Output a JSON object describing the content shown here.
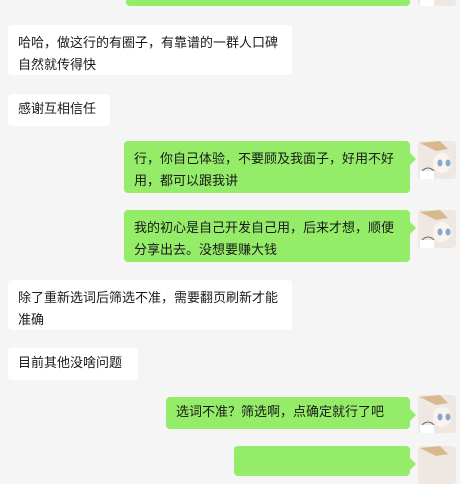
{
  "chat": {
    "messages": [
      {
        "side": "in",
        "text": "哈哈，做这行的有圈子，有靠谱的一群人口碑自然就传得快"
      },
      {
        "side": "in",
        "text": "感谢互相信任"
      },
      {
        "side": "out",
        "text": "行，你自己体验，不要顾及我面子，好用不好用，都可以跟我讲"
      },
      {
        "side": "out",
        "text": "我的初心是自己开发自己用，后来才想，顺便分享出去。没想要赚大钱"
      },
      {
        "side": "in",
        "text": "除了重新选词后筛选不准，需要翻页刷新才能准确"
      },
      {
        "side": "in",
        "text": "目前其他没啥问题"
      },
      {
        "side": "out",
        "text": "选词不准？筛选啊，点确定就行了吧"
      }
    ]
  },
  "avatar": {
    "icon": "anime-girl-avatar-icon"
  }
}
